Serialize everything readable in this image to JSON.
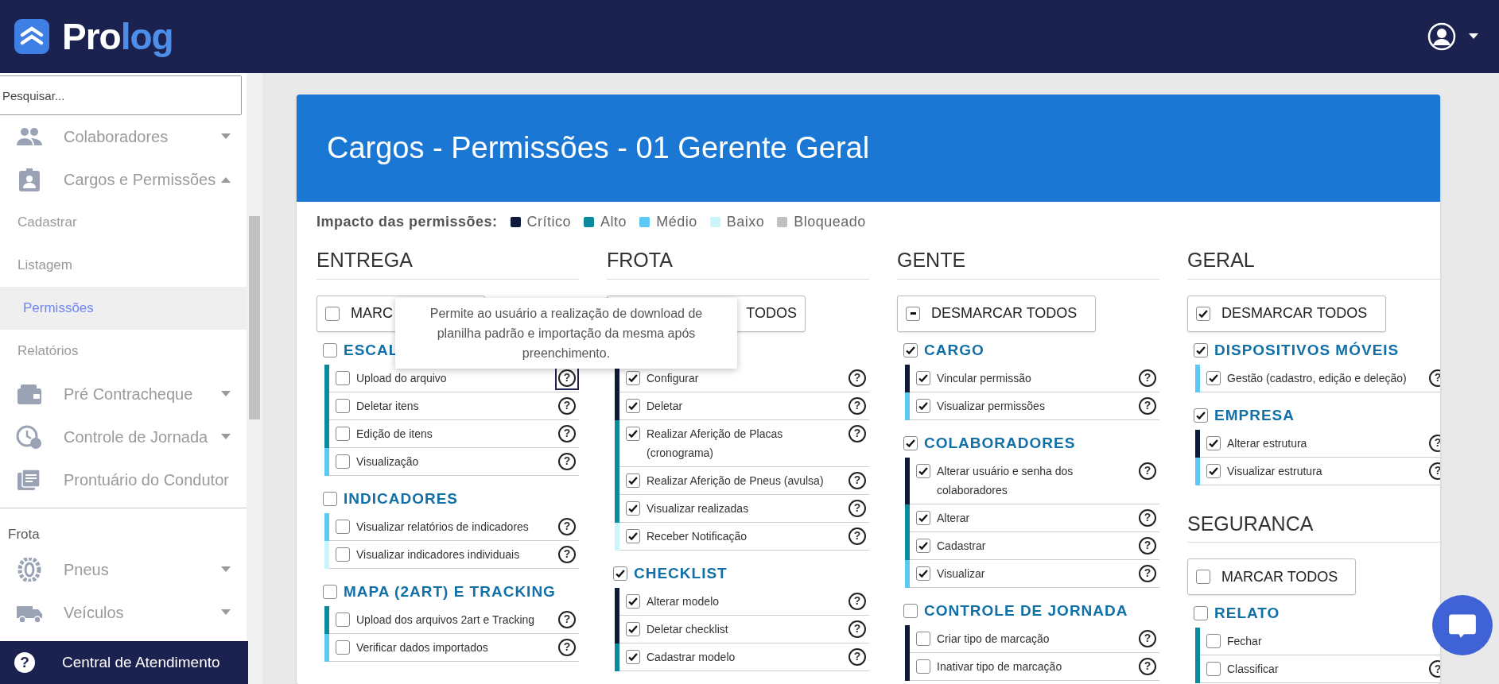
{
  "topbar": {
    "brand_first": "Pro",
    "brand_second": "log"
  },
  "sidebar": {
    "search": {
      "placeholder": "Pesquisar..."
    },
    "items": [
      {
        "kind": "menu",
        "label": "Colaboradores",
        "expanded": false
      },
      {
        "kind": "menu",
        "label": "Cargos e Permissões",
        "expanded": true
      },
      {
        "kind": "sub",
        "label": "Cadastrar",
        "selected": false
      },
      {
        "kind": "sub",
        "label": "Listagem",
        "selected": false
      },
      {
        "kind": "sub",
        "label": "Permissões",
        "selected": true
      },
      {
        "kind": "sub",
        "label": "Relatórios",
        "selected": false
      },
      {
        "kind": "menu",
        "label": "Pré Contracheque",
        "expanded": false
      },
      {
        "kind": "menu",
        "label": "Controle de Jornada",
        "expanded": false
      },
      {
        "kind": "link",
        "label": "Prontuário do Condutor"
      },
      {
        "kind": "divider"
      },
      {
        "kind": "heading",
        "label": "Frota"
      },
      {
        "kind": "menu",
        "label": "Pneus",
        "expanded": false
      },
      {
        "kind": "menu",
        "label": "Veículos",
        "expanded": false
      }
    ],
    "footer": {
      "icon": "?",
      "label": "Central de Atendimento"
    }
  },
  "page": {
    "title": "Cargos - Permissões - 01 Gerente Geral",
    "legend": {
      "label": "Impacto das permissões:",
      "items": [
        {
          "label": "Crítico",
          "color": "#0f1a3a"
        },
        {
          "label": "Alto",
          "color": "#0a8a9a"
        },
        {
          "label": "Médio",
          "color": "#5bc8f5"
        },
        {
          "label": "Baixo",
          "color": "#c9f6fb"
        },
        {
          "label": "Bloqueado",
          "color": "#c0c0c0"
        }
      ]
    },
    "tooltip": {
      "text": "Permite ao usuário a realização de download de planilha padrão e importação da mesma após preenchimento."
    },
    "columns": [
      {
        "groups": [
          {
            "title": "ENTREGA",
            "toggle": {
              "label": "MARC",
              "checked": false
            },
            "sections": [
              {
                "title": "ESCAL",
                "checked": false,
                "permissions": [
                  {
                    "label": "Upload do arquivo",
                    "checked": false,
                    "color": "#0a8a9a",
                    "help": "?",
                    "tooltip_open": true
                  },
                  {
                    "label": "Deletar itens",
                    "checked": false,
                    "color": "#0a8a9a",
                    "help": "?",
                    "tooltip_open": false
                  },
                  {
                    "label": "Edição de itens",
                    "checked": false,
                    "color": "#0a8a9a",
                    "help": "?",
                    "tooltip_open": false
                  },
                  {
                    "label": "Visualização",
                    "checked": false,
                    "color": "#5bc8f5",
                    "help": "?",
                    "tooltip_open": false
                  }
                ]
              },
              {
                "title": "INDICADORES",
                "checked": false,
                "permissions": [
                  {
                    "label": "Visualizar relatórios de indicadores",
                    "checked": false,
                    "color": "#5bc8f5",
                    "help": "?",
                    "tooltip_open": false
                  },
                  {
                    "label": "Visualizar indicadores individuais",
                    "checked": false,
                    "color": "#c9f6fb",
                    "help": "?",
                    "tooltip_open": false
                  }
                ]
              },
              {
                "title": "MAPA (2ART) E TRACKING",
                "checked": false,
                "permissions": [
                  {
                    "label": "Upload dos arquivos 2art e Tracking",
                    "checked": false,
                    "color": "#0a8a9a",
                    "help": "?",
                    "tooltip_open": false
                  },
                  {
                    "label": "Verificar dados importados",
                    "checked": false,
                    "color": "#5bc8f5",
                    "help": "?",
                    "tooltip_open": false
                  }
                ]
              }
            ]
          }
        ]
      },
      {
        "groups": [
          {
            "title": "FROTA",
            "toggle": {
              "label": "TODOS"
            },
            "sections": [
              {
                "permissions": [
                  {
                    "label": "Configurar",
                    "checked": true,
                    "color": "#0f1a3a",
                    "help": "?",
                    "tooltip_open": false
                  },
                  {
                    "label": "Deletar",
                    "checked": true,
                    "color": "#0f1a3a",
                    "help": "?",
                    "tooltip_open": false
                  },
                  {
                    "label": "Realizar Aferição de Placas (cronograma)",
                    "checked": true,
                    "color": "#0a8a9a",
                    "help": "?",
                    "tooltip_open": false
                  },
                  {
                    "label": "Realizar Aferição de Pneus (avulsa)",
                    "checked": true,
                    "color": "#0a8a9a",
                    "help": "?",
                    "tooltip_open": false
                  },
                  {
                    "label": "Visualizar realizadas",
                    "checked": true,
                    "color": "#0a8a9a",
                    "help": "?",
                    "tooltip_open": false
                  },
                  {
                    "label": "Receber Notificação",
                    "checked": true,
                    "color": "#c9f6fb",
                    "help": "?",
                    "tooltip_open": false
                  }
                ]
              },
              {
                "title": "CHECKLIST",
                "checked": true,
                "permissions": [
                  {
                    "label": "Alterar modelo",
                    "checked": true,
                    "color": "#0f1a3a",
                    "help": "?",
                    "tooltip_open": false
                  },
                  {
                    "label": "Deletar checklist",
                    "checked": true,
                    "color": "#0f1a3a",
                    "help": "?",
                    "tooltip_open": false
                  },
                  {
                    "label": "Cadastrar modelo",
                    "checked": true,
                    "color": "#0a8a9a",
                    "help": "?",
                    "tooltip_open": false
                  }
                ]
              }
            ]
          }
        ]
      },
      {
        "groups": [
          {
            "title": "GENTE",
            "toggle": {
              "label": "DESMARCAR TODOS",
              "checked": true,
              "partial": true
            },
            "sections": [
              {
                "title": "CARGO",
                "checked": true,
                "permissions": [
                  {
                    "label": "Vincular permissão",
                    "checked": true,
                    "color": "#0f1a3a",
                    "help": "?",
                    "tooltip_open": false
                  },
                  {
                    "label": "Visualizar permissões",
                    "checked": true,
                    "color": "#5bc8f5",
                    "help": "?",
                    "tooltip_open": false
                  }
                ]
              },
              {
                "title": "COLABORADORES",
                "checked": true,
                "permissions": [
                  {
                    "label": "Alterar usuário e senha dos colaboradores",
                    "checked": true,
                    "color": "#0f1a3a",
                    "help": "?",
                    "tooltip_open": false
                  },
                  {
                    "label": "Alterar",
                    "checked": true,
                    "color": "#0a8a9a",
                    "help": "?",
                    "tooltip_open": false
                  },
                  {
                    "label": "Cadastrar",
                    "checked": true,
                    "color": "#0a8a9a",
                    "help": "?",
                    "tooltip_open": false
                  },
                  {
                    "label": "Visualizar",
                    "checked": true,
                    "color": "#5bc8f5",
                    "help": "?",
                    "tooltip_open": false
                  }
                ]
              },
              {
                "title": "CONTROLE DE JORNADA",
                "checked": false,
                "permissions": [
                  {
                    "label": "Criar tipo de marcação",
                    "checked": false,
                    "color": "#0f1a3a",
                    "help": "?",
                    "tooltip_open": false
                  },
                  {
                    "label": "Inativar tipo de marcação",
                    "checked": false,
                    "color": "#0f1a3a",
                    "help": "?",
                    "tooltip_open": false
                  }
                ]
              }
            ]
          }
        ]
      },
      {
        "groups": [
          {
            "title": "GERAL",
            "toggle": {
              "label": "DESMARCAR TODOS",
              "checked": true
            },
            "sections": [
              {
                "title": "DISPOSITIVOS MÓVEIS",
                "checked": true,
                "permissions": [
                  {
                    "label": "Gestão (cadastro, edição e deleção)",
                    "checked": true,
                    "color": "#5bc8f5",
                    "help": "?",
                    "tooltip_open": false
                  }
                ]
              },
              {
                "title": "EMPRESA",
                "checked": true,
                "permissions": [
                  {
                    "label": "Alterar estrutura",
                    "checked": true,
                    "color": "#0f1a3a",
                    "help": "?",
                    "tooltip_open": false
                  },
                  {
                    "label": "Visualizar estrutura",
                    "checked": true,
                    "color": "#5bc8f5",
                    "help": "?",
                    "tooltip_open": false
                  }
                ]
              }
            ]
          },
          {
            "title": "SEGURANCA",
            "toggle": {
              "label": "MARCAR TODOS",
              "checked": false
            },
            "sections": [
              {
                "title": "RELATO",
                "checked": false,
                "permissions": [
                  {
                    "label": "Fechar",
                    "checked": false,
                    "color": "#0a8a9a"
                  },
                  {
                    "label": "Classificar",
                    "checked": false,
                    "color": "#0a8a9a",
                    "help": "?",
                    "tooltip_open": false
                  }
                ]
              }
            ]
          }
        ]
      }
    ]
  }
}
